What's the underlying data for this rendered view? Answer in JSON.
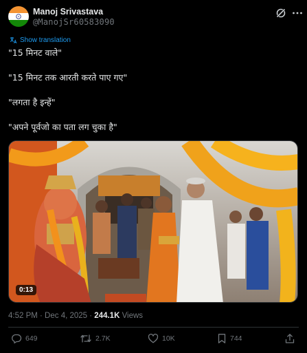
{
  "post": {
    "author_name": "Manoj Srivastava",
    "author_handle": "@ManojSr60583090",
    "show_translation": "Show translation",
    "lines": [
      "\"15 मिनट वाले\"",
      "\"15 मिनट तक आरती करते पाए गए\"",
      "\"लगता है इन्हें\"",
      "\"अपने पूर्वजो का पता लग चुका है\""
    ],
    "video_duration": "0:13",
    "timestamp": "4:52 PM · Dec 4, 2025 · ",
    "views_count": "244.1K",
    "views_label": " Views"
  },
  "actions": {
    "replies": "649",
    "reposts": "2.7K",
    "likes": "10K",
    "bookmarks": "744"
  },
  "icons": {
    "avatar": "india-flag-avatar",
    "grok": "grok-icon",
    "more": "more-icon",
    "reply": "reply-icon",
    "repost": "repost-icon",
    "like": "like-icon",
    "bookmark": "bookmark-icon",
    "share": "share-icon"
  },
  "colors": {
    "background": "#000000",
    "text": "#e7e9ea",
    "muted": "#71767b",
    "link": "#1d9bf0",
    "divider": "#2f3336"
  }
}
